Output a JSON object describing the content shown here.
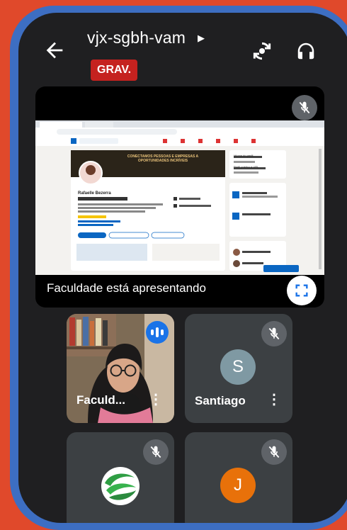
{
  "header": {
    "meeting_code": "vjx-sgbh-vam",
    "recording_badge": "GRAV."
  },
  "presentation": {
    "label": "Faculdade está apresentando",
    "screen": {
      "banner_text": "CONECTAMOS PESSOAS E EMPRESAS A OPORTUNIDADES INCRÍVEIS",
      "profile_name": "Rafaelle Bezerra",
      "sidebar_items": [
        "Idioma do perfil",
        "Perfil público e URL"
      ]
    }
  },
  "participants": [
    {
      "name": "Faculd...",
      "speaking": true
    },
    {
      "name": "Santiago",
      "initial": "S",
      "avatar_color": "#7f99a3",
      "muted": true
    },
    {
      "logo": "green-swirl-logo",
      "muted": true
    },
    {
      "initial": "J",
      "avatar_color": "#e8710a",
      "muted": true
    }
  ],
  "colors": {
    "background": "#e0492b",
    "frame": "#3d6ec2",
    "recording": "#c5221f",
    "tile": "#3c4043",
    "speaking": "#1a73e8"
  }
}
